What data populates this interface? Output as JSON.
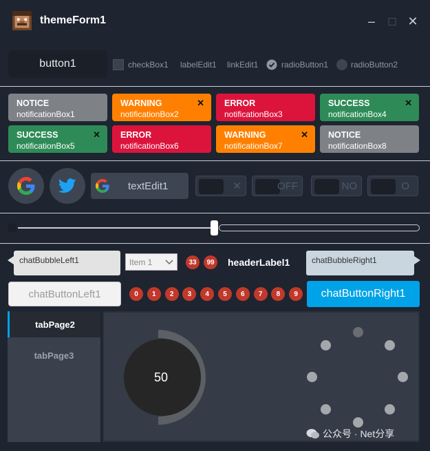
{
  "window": {
    "title": "themeForm1",
    "minimize": "–",
    "maximize": "□",
    "close": "✕"
  },
  "row1": {
    "button1": "button1",
    "checkbox1": "checkBox1",
    "labelEdit1": "labelEdit1",
    "linkEdit1": "linkEdit1",
    "radioButton1": "radioButton1",
    "radioButton2": "radioButton2"
  },
  "notifications": [
    {
      "title": "NOTICE",
      "name": "notificationBox1",
      "closable": false
    },
    {
      "title": "WARNING",
      "name": "notificationBox2",
      "closable": true
    },
    {
      "title": "ERROR",
      "name": "notificationBox3",
      "closable": false
    },
    {
      "title": "SUCCESS",
      "name": "notificationBox4",
      "closable": true
    },
    {
      "title": "SUCCESS",
      "name": "notificationBox5",
      "closable": true
    },
    {
      "title": "ERROR",
      "name": "notificationBox6",
      "closable": false
    },
    {
      "title": "WARNING",
      "name": "notificationBox7",
      "closable": true
    },
    {
      "title": "NOTICE",
      "name": "notificationBox8",
      "closable": false
    }
  ],
  "close_glyph": "✕",
  "row3": {
    "textEdit1": "textEdit1",
    "toggles": [
      "✕",
      "OFF",
      "NO",
      "O"
    ]
  },
  "slider": {
    "value_fraction": 0.49
  },
  "chat": {
    "bubbleLeft": "chatBubbleLeft1",
    "comboValue": "Item 1",
    "badge33": "33",
    "badge99": "99",
    "headerLabel": "headerLabel1",
    "bubbleRight": "chatBubbleRight1",
    "buttonLeft": "chatButtonLeft1",
    "buttonRight": "chatButtonRight1",
    "numberBadges": [
      "0",
      "1",
      "2",
      "3",
      "4",
      "5",
      "6",
      "7",
      "8",
      "9"
    ]
  },
  "tabs": {
    "tab1": "tabPage2",
    "tab2": "tabPage3"
  },
  "knob": {
    "value": "50"
  },
  "watermark": "公众号 · Net分享",
  "colors": {
    "accent": "#00a2e8",
    "badge": "#c0392b",
    "knobArc": "#5c5f63"
  }
}
